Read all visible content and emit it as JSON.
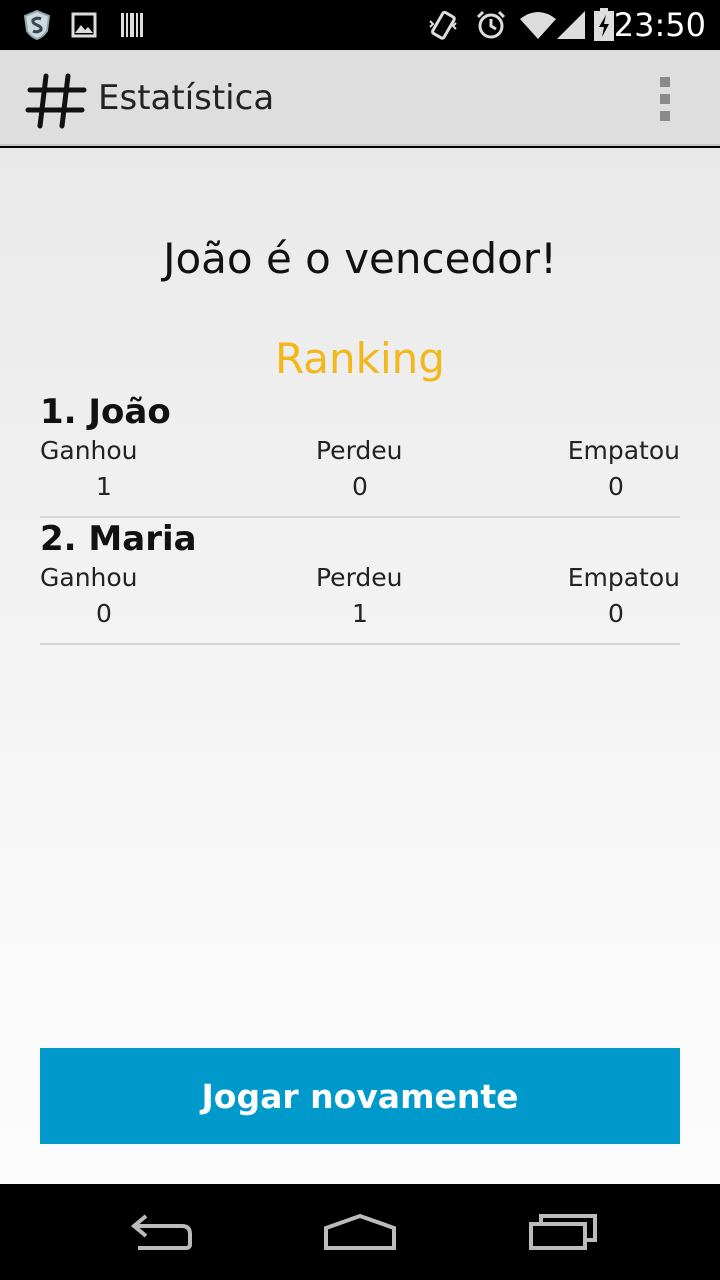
{
  "status_bar": {
    "time": "23:50",
    "icons": [
      "shield-app-icon",
      "image-notification-icon",
      "barcode-notification-icon",
      "vibrate-icon",
      "alarm-icon",
      "wifi-icon",
      "signal-icon",
      "battery-charging-icon"
    ]
  },
  "action_bar": {
    "app_icon": "hash-icon",
    "title": "Estatística",
    "overflow_icon": "overflow-menu-icon"
  },
  "winner_text": "João é o vencedor!",
  "ranking": {
    "title": "Ranking",
    "players": [
      {
        "name": "1. João",
        "wins_label": "Ganhou",
        "losses_label": "Perdeu",
        "draws_label": "Empatou",
        "wins": "1",
        "losses": "0",
        "draws": "0"
      },
      {
        "name": "2. Maria",
        "wins_label": "Ganhou",
        "losses_label": "Perdeu",
        "draws_label": "Empatou",
        "wins": "0",
        "losses": "1",
        "draws": "0"
      }
    ]
  },
  "play_again_label": "Jogar novamente",
  "colors": {
    "accent": "#f2b718",
    "button": "#0099cc"
  },
  "nav_bar": {
    "icons": [
      "back-icon",
      "home-icon",
      "recent-apps-icon"
    ]
  }
}
